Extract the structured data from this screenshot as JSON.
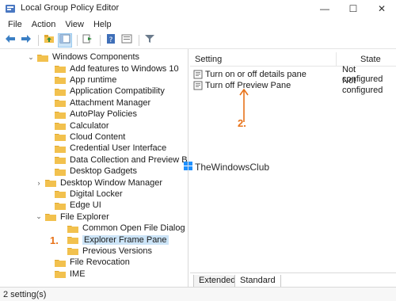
{
  "window": {
    "title": "Local Group Policy Editor",
    "min_glyph": "—",
    "max_glyph": "☐",
    "close_glyph": "✕"
  },
  "menu": [
    "File",
    "Action",
    "View",
    "Help"
  ],
  "toolbar": {
    "icons": [
      "back-arrow-icon",
      "forward-arrow-icon",
      "up-folder-icon",
      "show-hide-tree-icon",
      "export-list-icon",
      "help-icon",
      "properties-icon",
      "filter-icon"
    ]
  },
  "tree": {
    "items": [
      {
        "label": "Windows Components",
        "expander": "⌄"
      },
      {
        "label": "Add features to Windows 10",
        "expander": ""
      },
      {
        "label": "App runtime",
        "expander": ""
      },
      {
        "label": "Application Compatibility",
        "expander": ""
      },
      {
        "label": "Attachment Manager",
        "expander": ""
      },
      {
        "label": "AutoPlay Policies",
        "expander": ""
      },
      {
        "label": "Calculator",
        "expander": ""
      },
      {
        "label": "Cloud Content",
        "expander": ""
      },
      {
        "label": "Credential User Interface",
        "expander": ""
      },
      {
        "label": "Data Collection and Preview Builds",
        "expander": ""
      },
      {
        "label": "Desktop Gadgets",
        "expander": ""
      },
      {
        "label": "Desktop Window Manager",
        "expander": "›"
      },
      {
        "label": "Digital Locker",
        "expander": ""
      },
      {
        "label": "Edge UI",
        "expander": ""
      },
      {
        "label": "File Explorer",
        "expander": "⌄"
      },
      {
        "label": "Common Open File Dialog",
        "expander": ""
      },
      {
        "label": "Explorer Frame Pane",
        "expander": ""
      },
      {
        "label": "Previous Versions",
        "expander": ""
      },
      {
        "label": "File Revocation",
        "expander": ""
      },
      {
        "label": "IME",
        "expander": ""
      }
    ]
  },
  "right_pane": {
    "columns": {
      "setting": "Setting",
      "state": "State"
    },
    "rows": [
      {
        "name": "Turn on or off details pane",
        "state": "Not configured"
      },
      {
        "name": "Turn off Preview Pane",
        "state": "Not configured"
      }
    ]
  },
  "markers": {
    "one": "1.",
    "two": "2."
  },
  "watermark": {
    "text": "TheWindowsClub"
  },
  "tabs": [
    "Extended",
    "Standard"
  ],
  "status": {
    "text": "2 setting(s)"
  },
  "colors": {
    "accent_orange": "#e8731a",
    "selection": "#cce4f7",
    "folder": "#f2c14e"
  }
}
